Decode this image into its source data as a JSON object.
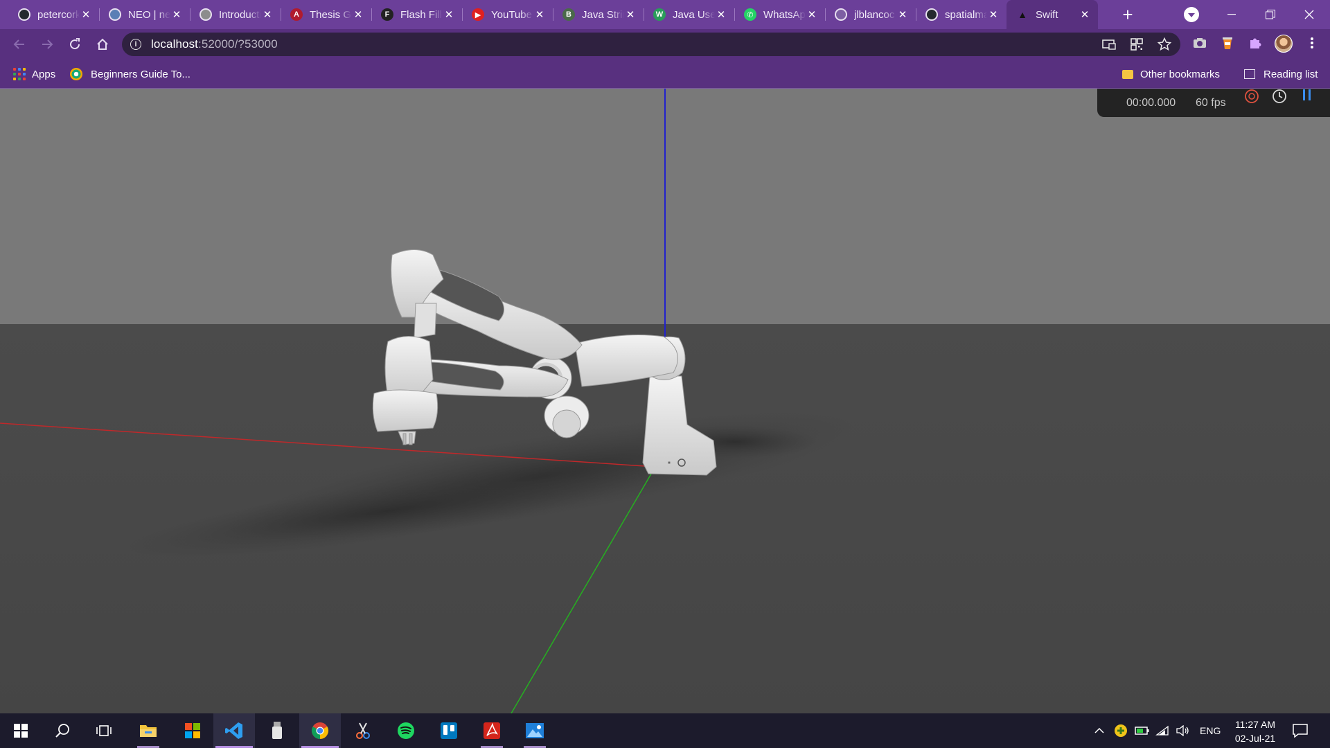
{
  "browser": {
    "tabs": [
      {
        "title": "petercorke/robotics-toolbox-python",
        "icon": "github-icon",
        "icon_color": "#24292e",
        "active": false
      },
      {
        "title": "NEO | neo",
        "icon": "globe-icon",
        "icon_color": "#5a7fb5",
        "active": false
      },
      {
        "title": "Introduction",
        "icon": "globe-icon",
        "icon_color": "#8c8c8c",
        "active": false
      },
      {
        "title": "Thesis Guidelines",
        "icon": "arizona-icon",
        "icon_color": "#b01b2e",
        "active": false
      },
      {
        "title": "Flash Fill",
        "icon": "f-icon",
        "icon_color": "#222222",
        "active": false
      },
      {
        "title": "YouTube",
        "icon": "youtube-icon",
        "icon_color": "#e02020",
        "active": false
      },
      {
        "title": "Java Strings",
        "icon": "b-icon",
        "icon_color": "#4a6a4a",
        "active": false
      },
      {
        "title": "Java User Input",
        "icon": "w3schools-icon",
        "icon_color": "#2a9d5a",
        "active": false
      },
      {
        "title": "WhatsApp",
        "icon": "whatsapp-icon",
        "icon_color": "#25d366",
        "active": false
      },
      {
        "title": "jlblancoc",
        "icon": "globe-icon",
        "icon_color": "#7d5fa3",
        "active": false
      },
      {
        "title": "spatialmath",
        "icon": "github-icon",
        "icon_color": "#24292e",
        "active": false
      },
      {
        "title": "Swift",
        "icon": "swift-icon",
        "icon_color": "#111111",
        "active": true
      }
    ],
    "new_tab_label": "+",
    "url_host": "localhost",
    "url_rest": ":52000/?53000",
    "bookmarks": {
      "apps_label": "Apps",
      "beginners_label": "Beginners Guide To...",
      "other_label": "Other bookmarks",
      "reading_label": "Reading list"
    },
    "theme_color": "#6b3f99"
  },
  "viewer": {
    "time": "00:00.000",
    "fps": "60 fps",
    "axis_colors": {
      "x": "#c0282a",
      "y": "#25b020",
      "z": "#2222cc"
    },
    "floor_color": "#4a4a4a",
    "sky_color": "#7a7a7a"
  },
  "taskbar": {
    "lang": "ENG",
    "time": "11:27 AM",
    "date": "02-Jul-21",
    "apps": [
      "start-icon",
      "search-icon",
      "task-view-icon",
      "file-explorer-icon",
      "microsoft-store-icon",
      "vscode-icon",
      "usb-app-icon",
      "chrome-icon",
      "snip-icon",
      "spotify-icon",
      "trello-icon",
      "acrobat-icon",
      "photos-icon"
    ]
  }
}
